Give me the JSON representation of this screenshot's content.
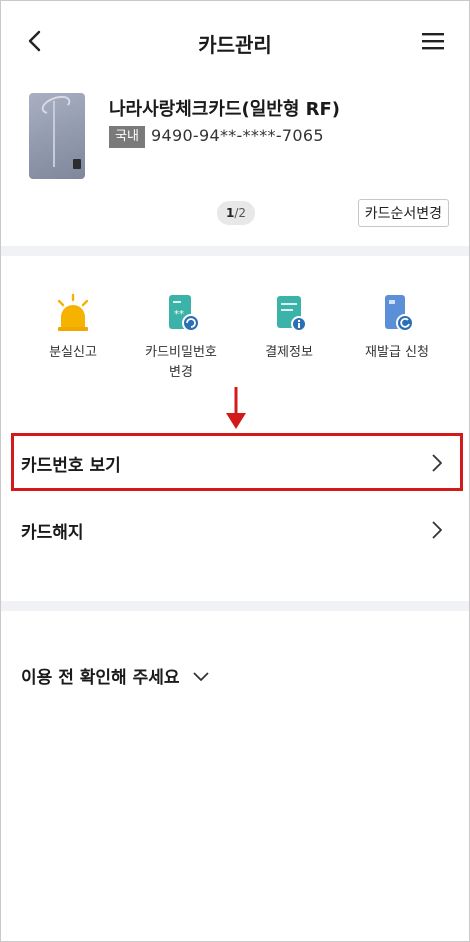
{
  "header": {
    "title": "카드관리",
    "back_icon": "chevron-left-icon",
    "menu_icon": "hamburger-menu-icon"
  },
  "card": {
    "name": "나라사랑체크카드(일반형 RF)",
    "badge": "국내",
    "number": "9490-94**-****-7065",
    "pager": {
      "current": "1",
      "total": "/2"
    },
    "reorder_label": "카드순서변경"
  },
  "actions": [
    {
      "label": "분실신고",
      "icon": "siren-icon"
    },
    {
      "label": "카드비밀번호\n변경",
      "icon": "card-password-icon"
    },
    {
      "label": "결제정보",
      "icon": "payment-info-icon"
    },
    {
      "label": "재발급 신청",
      "icon": "reissue-icon"
    }
  ],
  "menu": [
    {
      "label": "카드번호 보기",
      "highlighted": true
    },
    {
      "label": "카드해지",
      "highlighted": false
    }
  ],
  "notice": {
    "label": "이용 전 확인해 주세요"
  },
  "colors": {
    "highlight": "#d31a1a",
    "siren": "#f5b300",
    "teal_icon": "#3bb3a8",
    "blue_icon": "#3d8fd6",
    "divider": "#f1f2f5"
  }
}
